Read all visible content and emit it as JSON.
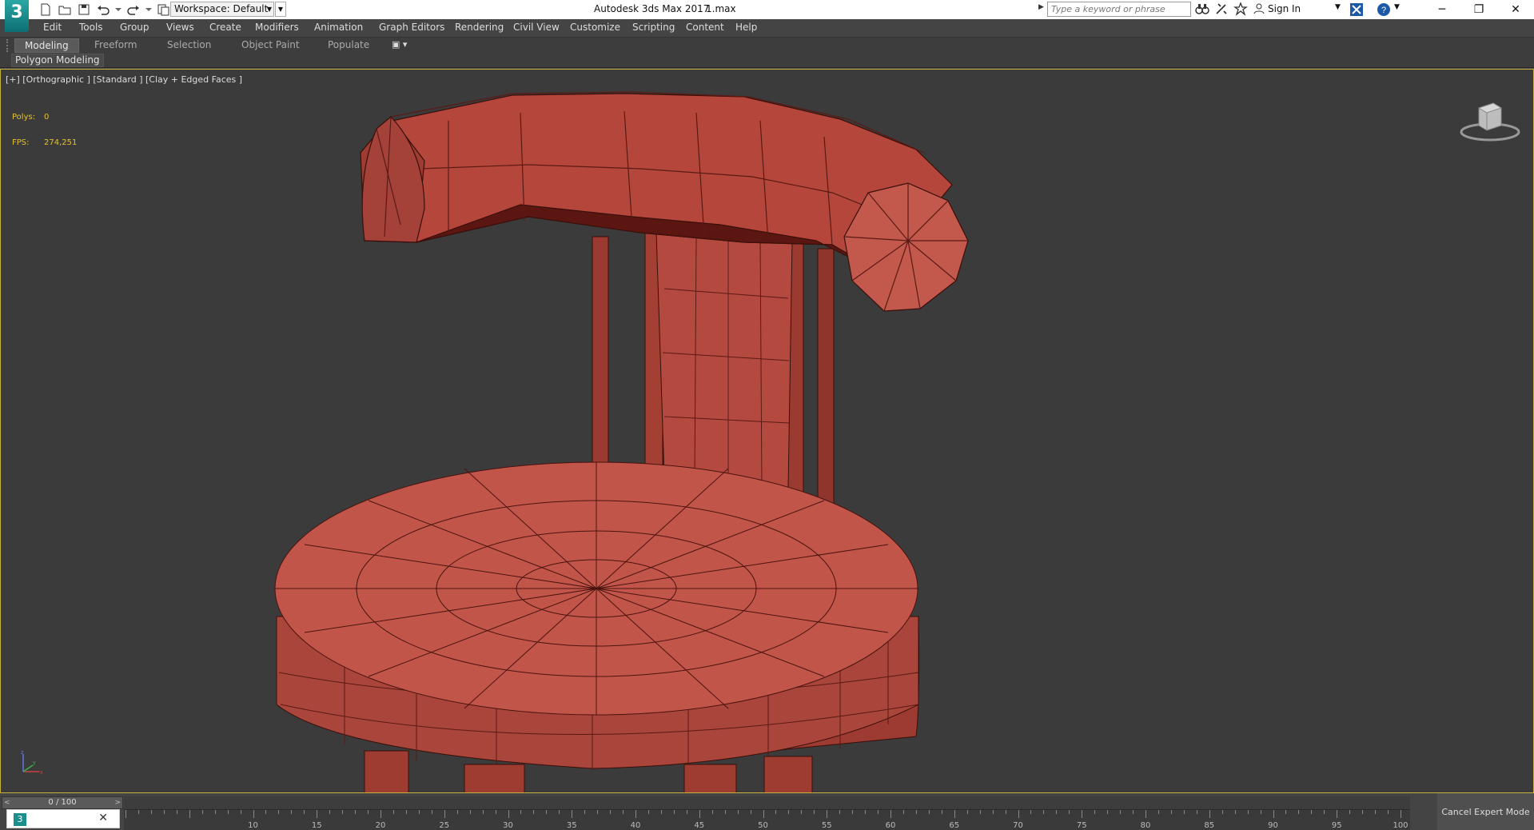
{
  "app": {
    "logo_text": "3",
    "title": "Autodesk 3ds Max 2017",
    "file": "1.max",
    "workspace_label": "Workspace: Default",
    "search_placeholder": "Type a keyword or phrase",
    "signin_label": "Sign In"
  },
  "menu": [
    "Edit",
    "Tools",
    "Group",
    "Views",
    "Create",
    "Modifiers",
    "Animation",
    "Graph Editors",
    "Rendering",
    "Civil View",
    "Customize",
    "Scripting",
    "Content",
    "Help"
  ],
  "ribbon": {
    "tabs": [
      "Modeling",
      "Freeform",
      "Selection",
      "Object Paint",
      "Populate"
    ],
    "active_tab": "Modeling",
    "panel_label": "Polygon Modeling"
  },
  "viewport": {
    "label": "[+] [Orthographic ] [Standard ] [Clay + Edged Faces ]",
    "polys_label": "Polys:",
    "polys_value": "0",
    "fps_label": "FPS:",
    "fps_value": "274,251",
    "model_color": "#b5463c",
    "accent_border": "#c8b13a"
  },
  "timeline": {
    "frame_display": "0 / 100",
    "ticks": [
      "10",
      "15",
      "20",
      "25",
      "30",
      "35",
      "40",
      "45",
      "50",
      "55",
      "60",
      "65",
      "70",
      "75",
      "80",
      "85",
      "90",
      "95",
      "100"
    ]
  },
  "status": {
    "cancel_expert_label": "Cancel Expert Mode"
  }
}
